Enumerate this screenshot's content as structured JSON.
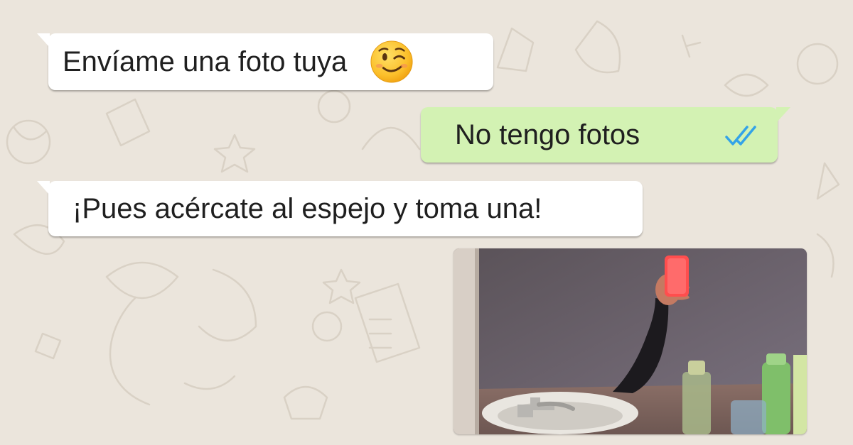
{
  "background_color": "#ebe5dc",
  "messages": [
    {
      "direction": "incoming",
      "text": "Envíame una foto tuya",
      "emoji": "winking-face-icon"
    },
    {
      "direction": "outgoing",
      "text": "No tengo fotos",
      "status": "read-double-check-icon",
      "status_color": "#33a3e8"
    },
    {
      "direction": "incoming",
      "text": "¡Pues acércate al espejo y toma una!"
    },
    {
      "direction": "incoming",
      "type": "image",
      "image": "mirror-selfie-arm-with-red-phone"
    }
  ],
  "colors": {
    "incoming_bubble": "#ffffff",
    "outgoing_bubble": "#d3f2b3",
    "text": "#1f1f1f"
  }
}
